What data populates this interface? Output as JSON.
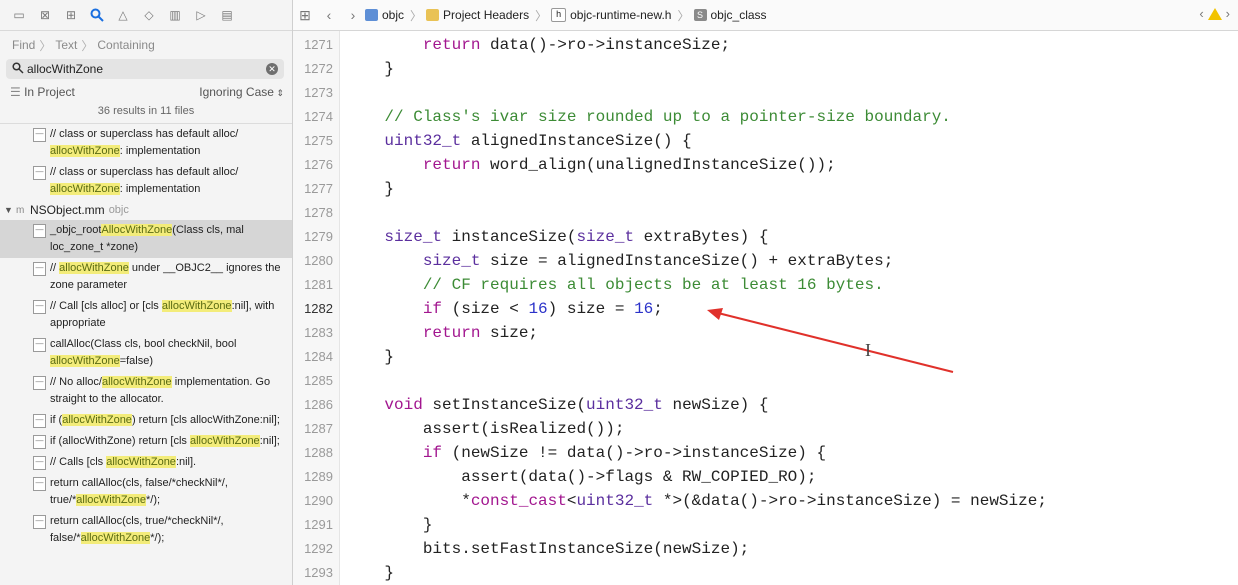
{
  "navigator": {
    "icons": [
      "folder-icon",
      "source-control-icon",
      "hierarchy-icon",
      "search-icon",
      "warning-icon",
      "test-icon",
      "debug-icon",
      "breakpoint-icon",
      "report-icon"
    ],
    "find_path": [
      "Find",
      "Text",
      "Containing"
    ],
    "search": {
      "value": "allocWithZone"
    },
    "scope": "In Project",
    "case_mode": "Ignoring Case",
    "results_summary": "36 results in 11 files",
    "file": {
      "name": "NSObject.mm",
      "group": "objc"
    },
    "results_before_file": [
      [
        "// class or superclass has default alloc/ ",
        "allocWithZone",
        ": implementation"
      ],
      [
        "// class or superclass has default alloc/ ",
        "allocWithZone",
        ": implementation"
      ]
    ],
    "results": [
      [
        "_objc_root",
        "AllocWithZone",
        "(Class cls, mal loc_zone_t *zone)"
      ],
      [
        "// ",
        "allocWithZone",
        " under __OBJC2__ ignores the zone parameter"
      ],
      [
        "// Call [cls alloc] or [cls ",
        "allocWithZone",
        ":nil], with appropriate"
      ],
      [
        "callAlloc(Class cls, bool checkNil, bool ",
        "allocWithZone",
        "=false)"
      ],
      [
        "// No alloc/",
        "allocWithZone",
        " implementation. Go straight to the allocator."
      ],
      [
        "if (",
        "allocWithZone",
        ") return [cls allocWithZone:nil];"
      ],
      [
        "if (allocWithZone) return [cls ",
        "allocWithZone",
        ":nil];"
      ],
      [
        "// Calls [cls ",
        "allocWithZone",
        ":nil]."
      ],
      [
        "return callAlloc(cls, false/*checkNil*/, true/*",
        "allocWithZone",
        "*/);"
      ],
      [
        "return callAlloc(cls, true/*checkNil*/, false/*",
        "allocWithZone",
        "*/);"
      ]
    ]
  },
  "breadcrumb": [
    "objc",
    "Project Headers",
    "objc-runtime-new.h",
    "objc_class"
  ],
  "editor": {
    "current_line": "1282",
    "lines": [
      {
        "n": "1271",
        "t": "        return data()->ro->instanceSize;"
      },
      {
        "n": "1272",
        "t": "    }"
      },
      {
        "n": "1273",
        "t": ""
      },
      {
        "n": "1274",
        "t": "    // Class's ivar size rounded up to a pointer-size boundary."
      },
      {
        "n": "1275",
        "t": "    uint32_t alignedInstanceSize() {"
      },
      {
        "n": "1276",
        "t": "        return word_align(unalignedInstanceSize());"
      },
      {
        "n": "1277",
        "t": "    }"
      },
      {
        "n": "1278",
        "t": ""
      },
      {
        "n": "1279",
        "t": "    size_t instanceSize(size_t extraBytes) {"
      },
      {
        "n": "1280",
        "t": "        size_t size = alignedInstanceSize() + extraBytes;"
      },
      {
        "n": "1281",
        "t": "        // CF requires all objects be at least 16 bytes."
      },
      {
        "n": "1282",
        "t": "        if (size < 16) size = 16;"
      },
      {
        "n": "1283",
        "t": "        return size;"
      },
      {
        "n": "1284",
        "t": "    }"
      },
      {
        "n": "1285",
        "t": ""
      },
      {
        "n": "1286",
        "t": "    void setInstanceSize(uint32_t newSize) {"
      },
      {
        "n": "1287",
        "t": "        assert(isRealized());"
      },
      {
        "n": "1288",
        "t": "        if (newSize != data()->ro->instanceSize) {"
      },
      {
        "n": "1289",
        "t": "            assert(data()->flags & RW_COPIED_RO);"
      },
      {
        "n": "1290",
        "t": "            *const_cast<uint32_t *>(&data()->ro->instanceSize) = newSize;"
      },
      {
        "n": "1291",
        "t": "        }"
      },
      {
        "n": "1292",
        "t": "        bits.setFastInstanceSize(newSize);"
      },
      {
        "n": "1293",
        "t": "    }"
      }
    ]
  },
  "annotation": {
    "color": "#e0312b"
  },
  "colors": {
    "keyword": "#a2168f",
    "type": "#5b2f9e",
    "comment": "#3c8b35",
    "number": "#2b32c9",
    "match_highlight": "#f3ec7a"
  }
}
